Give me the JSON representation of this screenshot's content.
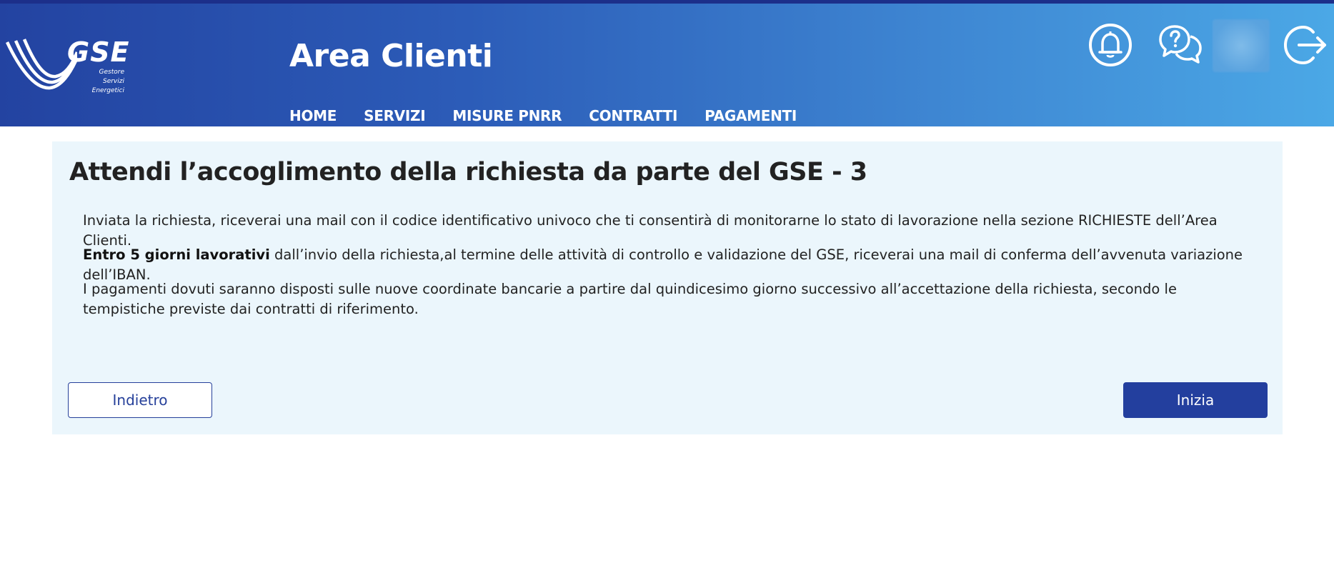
{
  "header": {
    "logo": {
      "name": "GSE",
      "sub": [
        "Gestore",
        "Servizi",
        "Energetici"
      ]
    },
    "app_title": "Area Clienti",
    "nav": [
      {
        "label": "HOME"
      },
      {
        "label": "SERVIZI"
      },
      {
        "label": "MISURE PNRR"
      },
      {
        "label": "CONTRATTI"
      },
      {
        "label": "PAGAMENTI"
      }
    ],
    "icons": [
      "bell-icon",
      "help-chat-icon",
      "avatar",
      "logout-icon"
    ]
  },
  "main": {
    "title": "Attendi l’accoglimento della richiesta da parte del GSE - 3",
    "paragraphs": {
      "p1": "Inviata la richiesta, riceverai una mail con il codice identificativo univoco che ti consentirà di monitorarne lo stato di lavorazione nella sezione RICHIESTE dell’Area Clienti.",
      "p2_bold": "Entro 5 giorni lavorativi",
      "p2_rest": " dall’invio della richiesta,al termine delle attività di controllo e validazione del GSE, riceverai una mail di conferma dell’avvenuta variazione dell’IBAN.",
      "p3": "I pagamenti dovuti saranno disposti sulle nuove coordinate bancarie a partire dal quindicesimo giorno successivo all’accettazione della richiesta, secondo le tempistiche previste dai contratti di riferimento."
    },
    "buttons": {
      "back": "Indietro",
      "start": "Inizia"
    }
  },
  "colors": {
    "header_start": "#2343a1",
    "header_end": "#4ba8e6",
    "card_bg": "#ebf6fc",
    "primary": "#233f9e"
  }
}
